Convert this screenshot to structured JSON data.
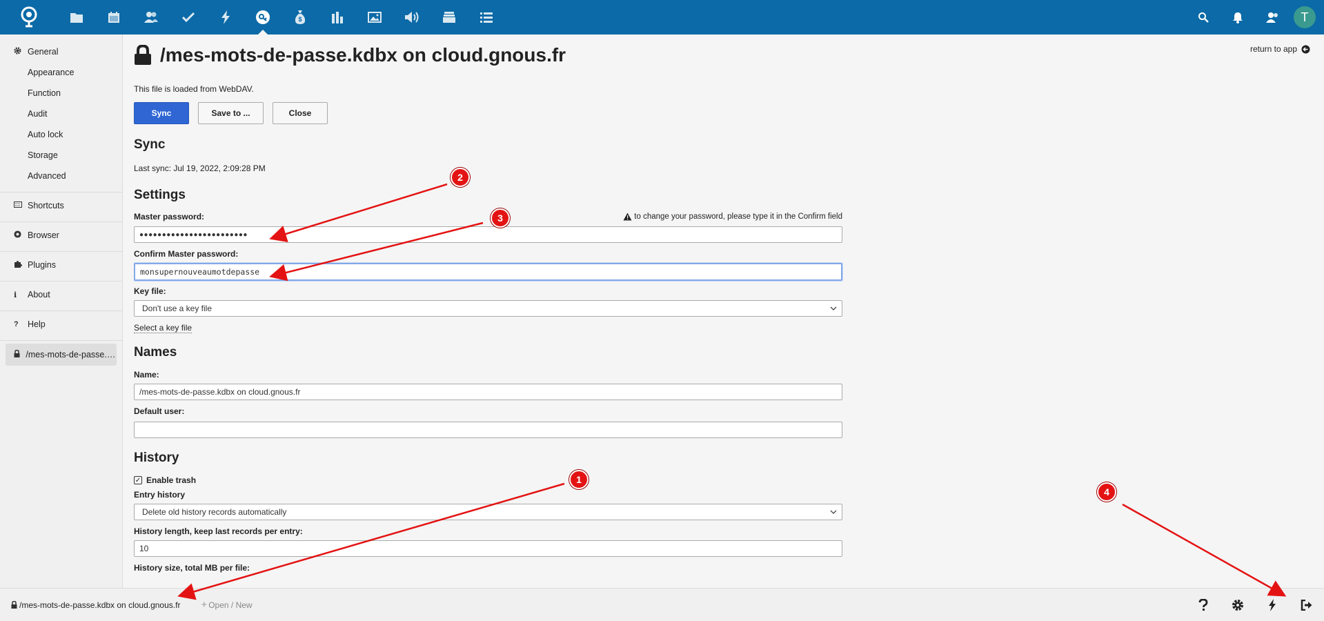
{
  "topbar": {
    "apps": [
      {
        "name": "files-icon",
        "active": false
      },
      {
        "name": "calendar-icon",
        "active": false
      },
      {
        "name": "contacts-icon",
        "active": false
      },
      {
        "name": "tasks-icon",
        "active": false
      },
      {
        "name": "activity-icon",
        "active": false
      },
      {
        "name": "keeweb-icon",
        "active": true
      },
      {
        "name": "money-icon",
        "active": false
      },
      {
        "name": "analytics-icon",
        "active": false
      },
      {
        "name": "photos-icon",
        "active": false
      },
      {
        "name": "audio-icon",
        "active": false
      },
      {
        "name": "deck-icon",
        "active": false
      },
      {
        "name": "list-icon",
        "active": false
      }
    ],
    "avatar_letter": "T"
  },
  "sidebar": {
    "general": "General",
    "general_items": [
      "Appearance",
      "Function",
      "Audit",
      "Auto lock",
      "Storage",
      "Advanced"
    ],
    "shortcuts": "Shortcuts",
    "browser": "Browser",
    "plugins": "Plugins",
    "about": "About",
    "help": "Help",
    "file": "/mes-mots-de-passe.kdbx on cloud.gnous.fr"
  },
  "main": {
    "title": "/mes-mots-de-passe.kdbx on cloud.gnous.fr",
    "return_to_app": "return to app",
    "loaded_from": "This file is loaded from WebDAV.",
    "buttons": {
      "sync": "Sync",
      "save_to": "Save to ...",
      "close": "Close"
    },
    "sync": {
      "heading": "Sync",
      "last_sync": "Last sync: Jul 19, 2022, 2:09:28 PM"
    },
    "settings": {
      "heading": "Settings",
      "master_password_label": "Master password:",
      "master_password_value": "●●●●●●●●●●●●●●●●●●●●●●●●",
      "change_hint": "to change your password, please type it in the Confirm field",
      "confirm_label": "Confirm Master password:",
      "confirm_value": "monsupernouveaumotdepasse",
      "key_file_label": "Key file:",
      "key_file_value": "Don't use a key file",
      "select_key_file": "Select a key file"
    },
    "names": {
      "heading": "Names",
      "name_label": "Name:",
      "name_value": "/mes-mots-de-passe.kdbx on cloud.gnous.fr",
      "default_user_label": "Default user:",
      "default_user_value": ""
    },
    "history": {
      "heading": "History",
      "enable_trash": "Enable trash",
      "entry_history_label": "Entry history",
      "entry_history_value": "Delete old history records automatically",
      "history_length_label": "History length, keep last records per entry:",
      "history_length_value": "10",
      "history_size_label": "History size, total MB per file:"
    }
  },
  "footer": {
    "file": "/mes-mots-de-passe.kdbx on cloud.gnous.fr",
    "open_new": "Open / New"
  },
  "annotations": {
    "marker_1": "1",
    "marker_2": "2",
    "marker_3": "3",
    "marker_4": "4",
    "color": "#e41313"
  }
}
